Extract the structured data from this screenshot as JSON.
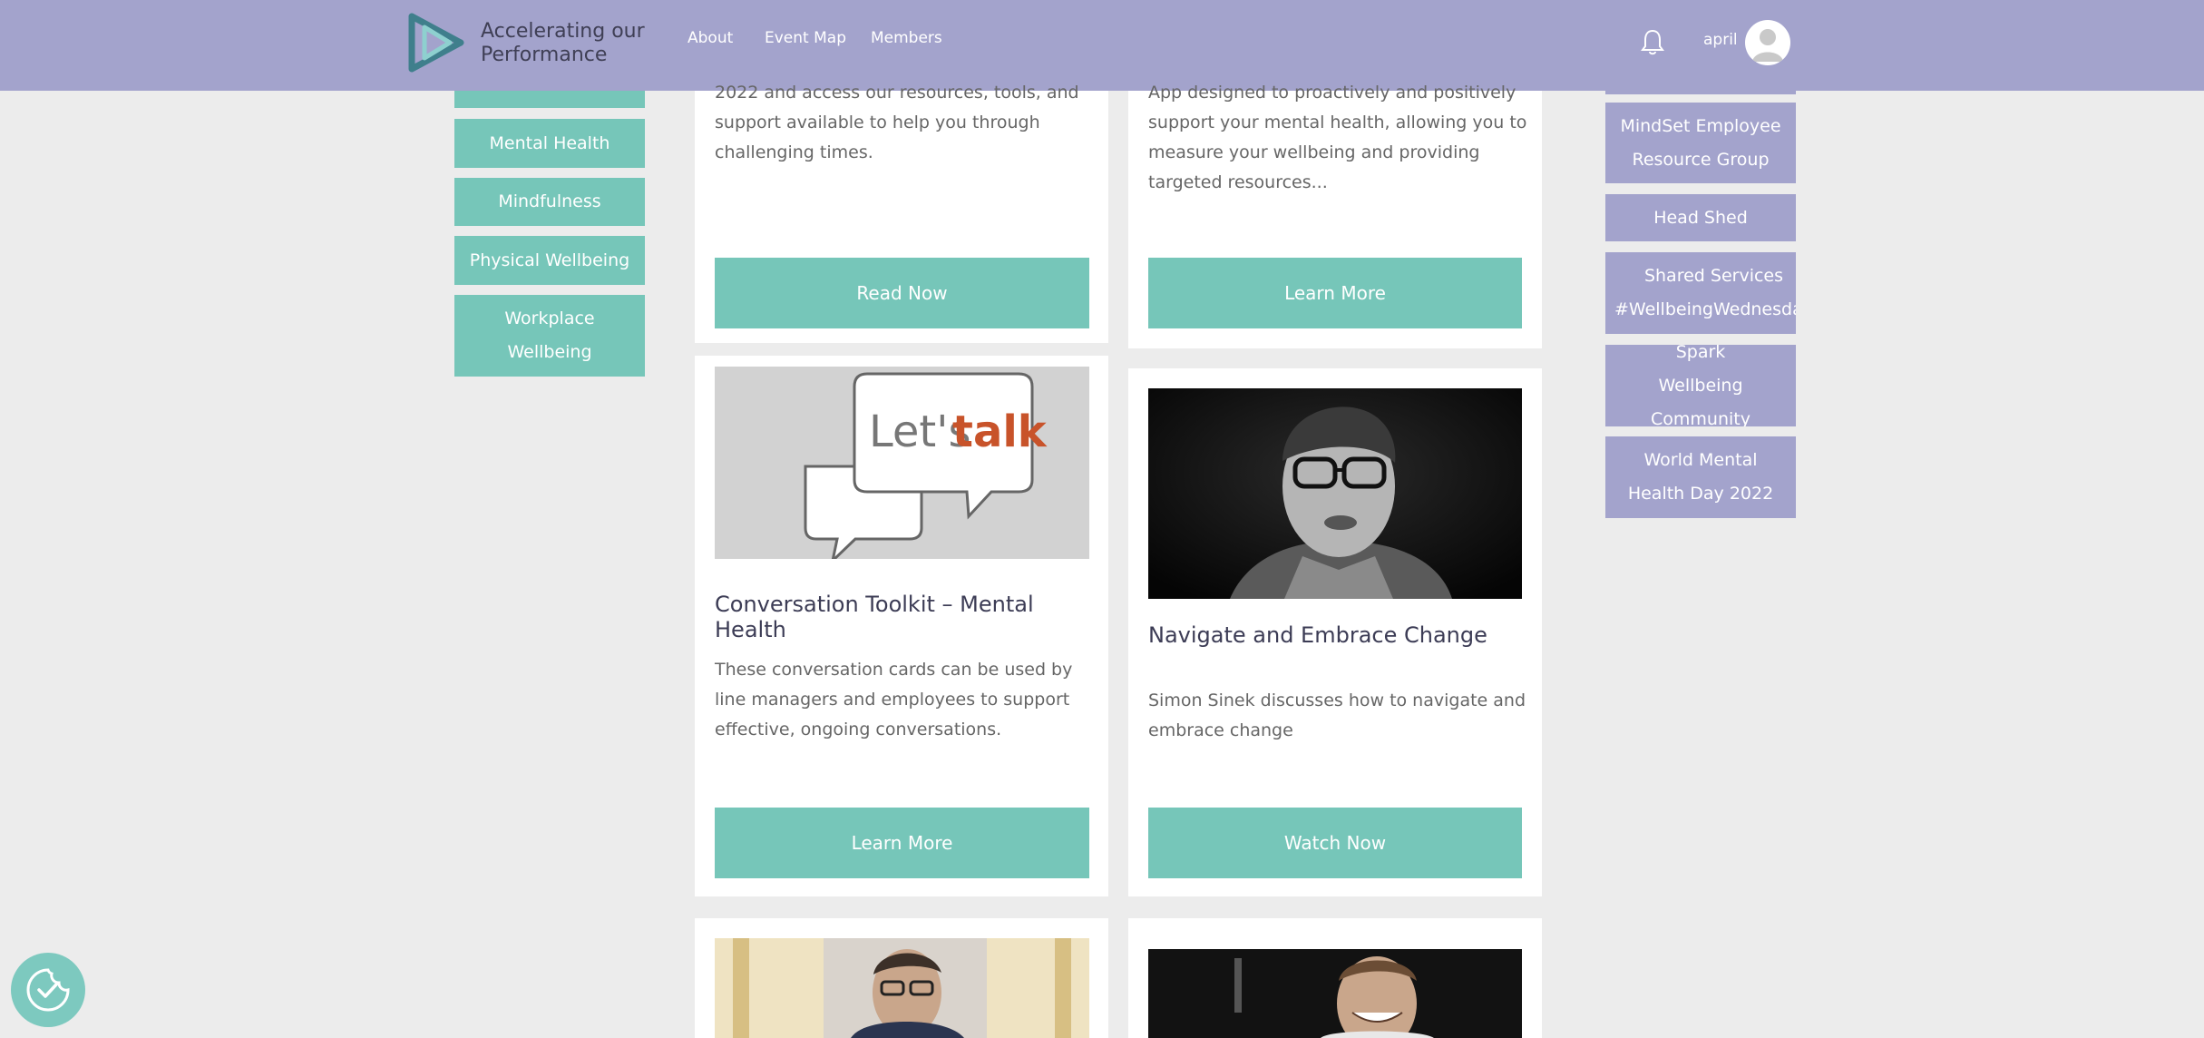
{
  "header": {
    "logo_line1": "Accelerating our",
    "logo_line2": "Performance",
    "nav": [
      "About",
      "Event Map",
      "Members"
    ],
    "user": "april"
  },
  "left_sidebar": [
    "Mental Health",
    "Mindfulness",
    "Physical Wellbeing",
    "Workplace Wellbeing"
  ],
  "right_sidebar": [
    "MindSet Employee Resource Group",
    "Head Shed",
    "Shared Services #WellbeingWednesday",
    "Spark Wellbeing Community",
    "World Mental Health Day 2022"
  ],
  "cards": {
    "top_left": {
      "text": "2022 and access our resources, tools, and support available to help you through challenging times.",
      "button": "Read Now"
    },
    "top_right": {
      "text": "App designed to proactively and positively support your mental health, allowing you to measure your wellbeing and providing targeted resources...",
      "button": "Learn More"
    },
    "mid_left": {
      "image_text_1": "Let's",
      "image_text_2": "talk",
      "title": "Conversation Toolkit – Mental Health",
      "text": "These conversation cards can be used by line managers and employees to support effective, ongoing conversations.",
      "button": "Learn More"
    },
    "mid_right": {
      "title": "Navigate and Embrace Change",
      "text": "Simon Sinek discusses how to navigate and embrace change",
      "button": "Watch Now"
    }
  },
  "colors": {
    "header": "#a3a3cc",
    "teal": "#76c6b9",
    "background": "#ececec"
  }
}
